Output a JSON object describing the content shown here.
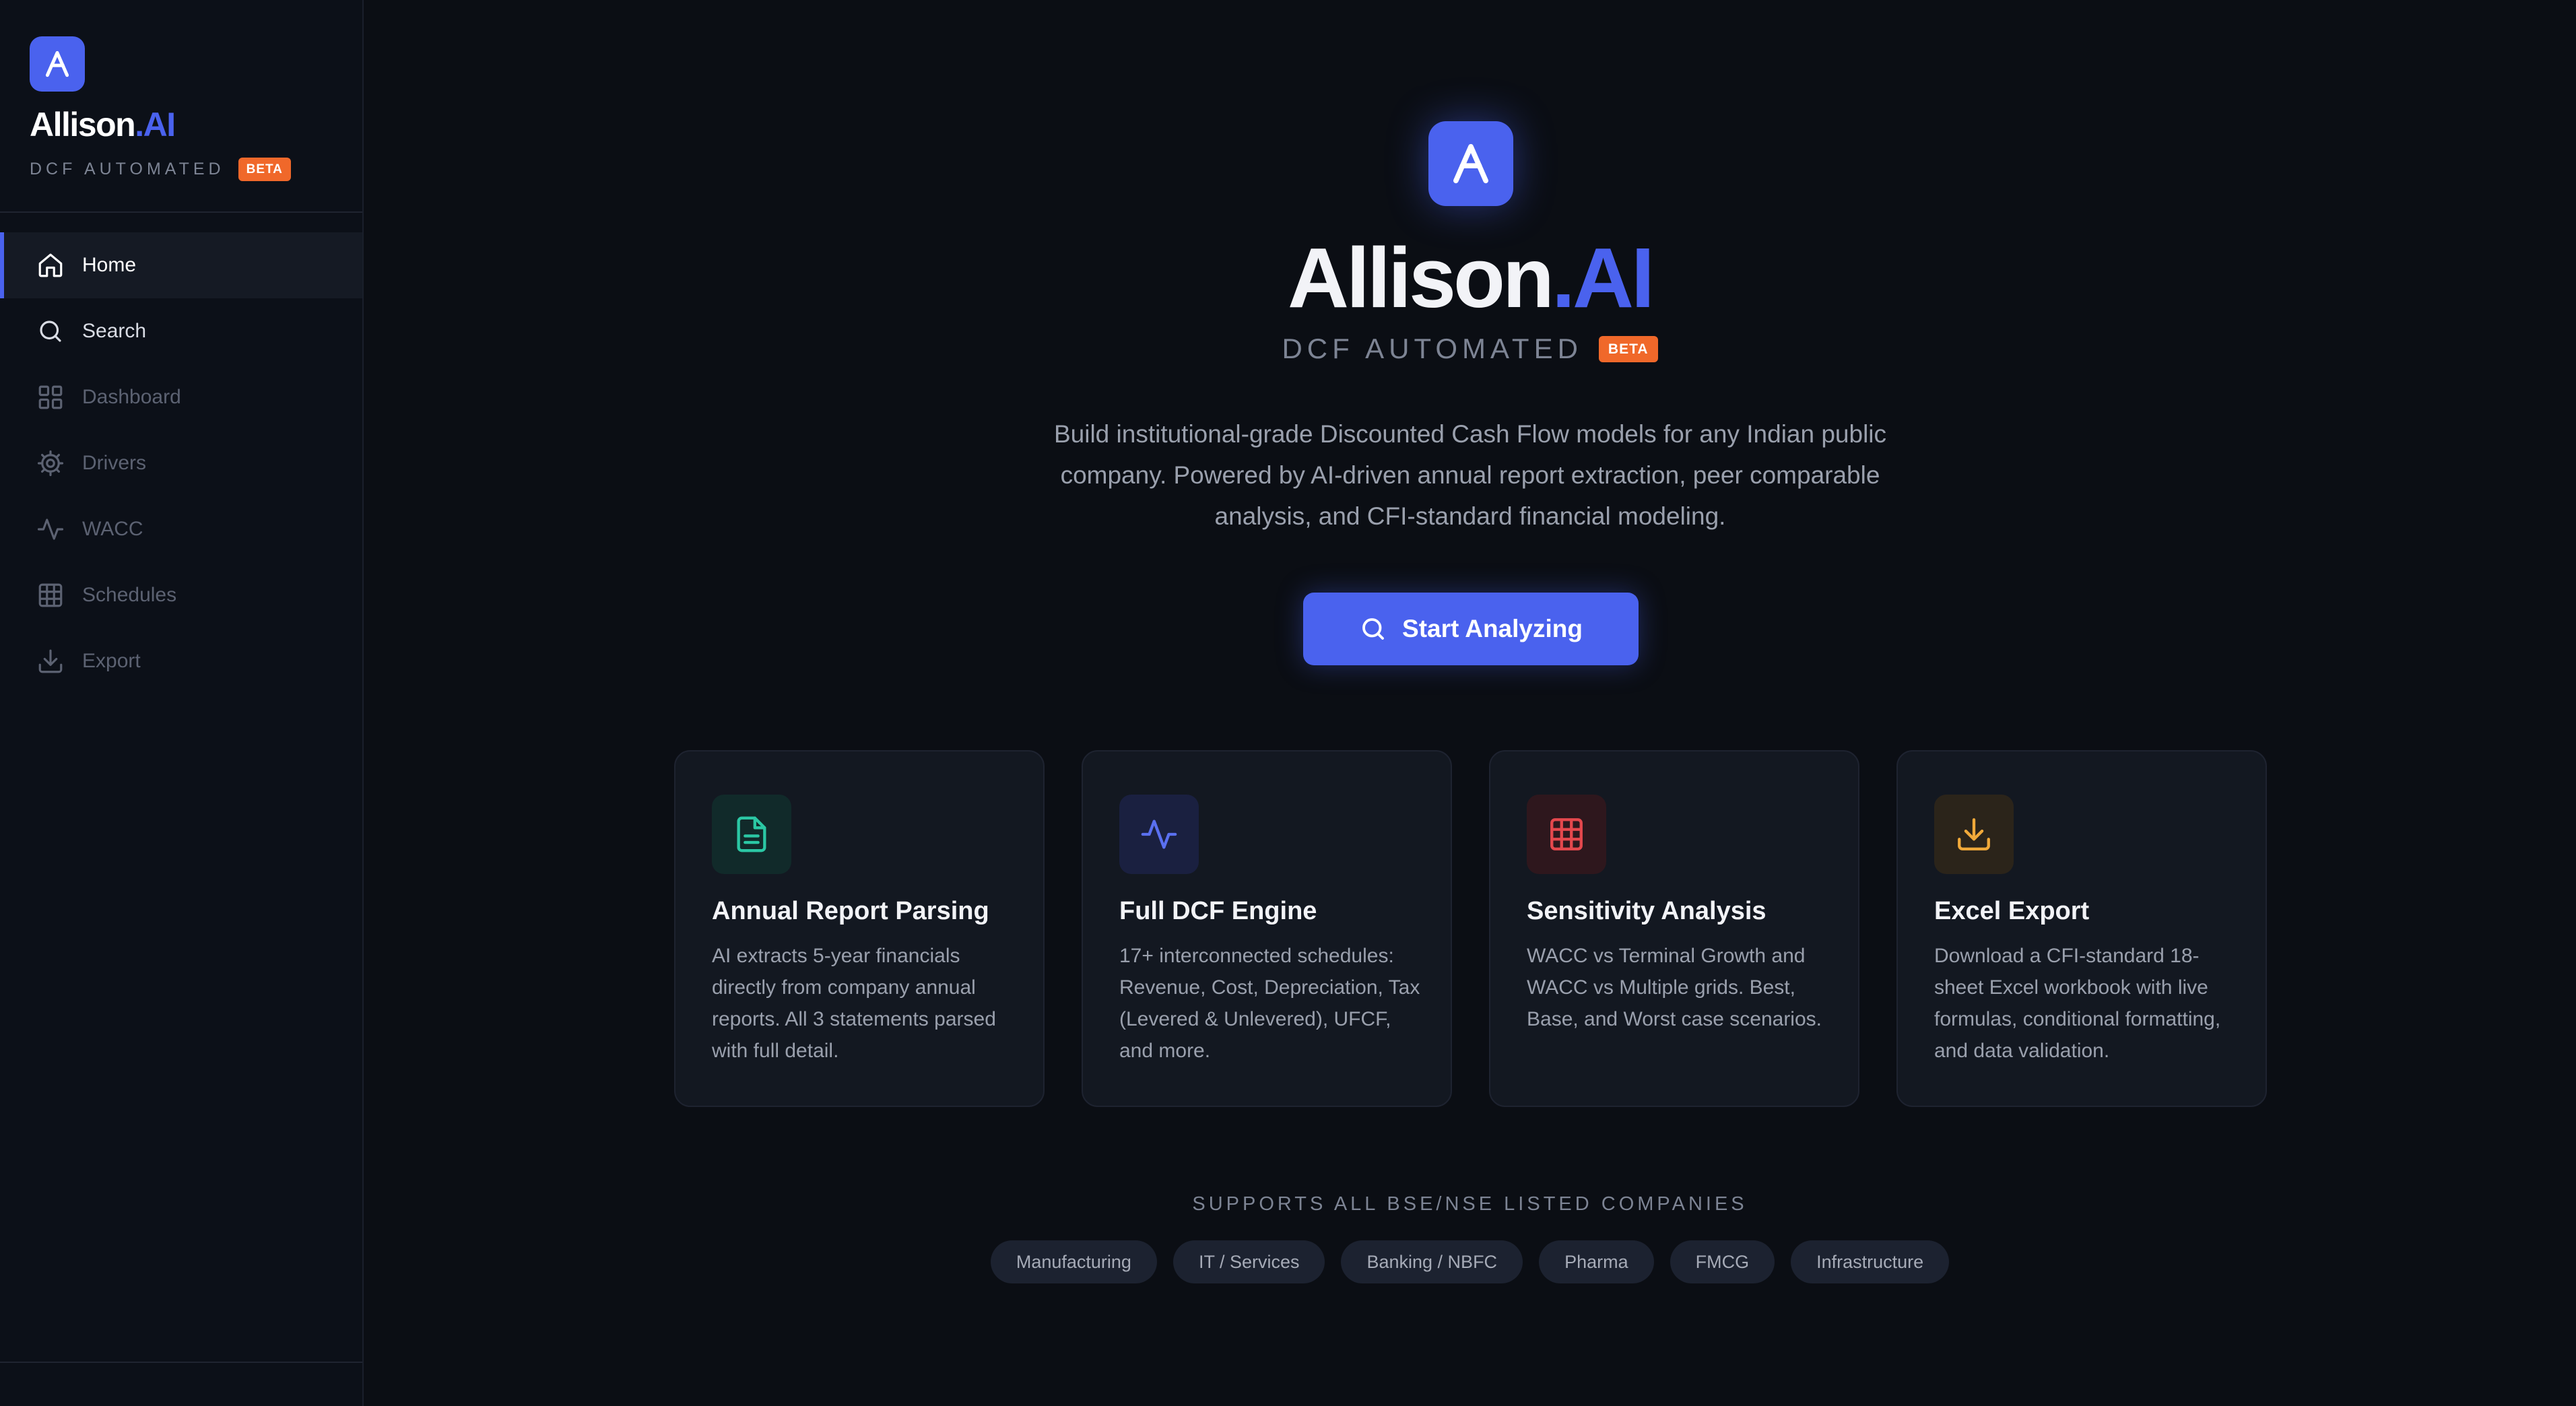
{
  "brand": {
    "name": "Allison",
    "suffix": ".AI",
    "tagline": "DCF AUTOMATED",
    "badge": "BETA",
    "logo_icon": "allison-logo-icon",
    "accent": "#4a62ee",
    "badge_color": "#f0682a"
  },
  "sidebar": {
    "items": [
      {
        "label": "Home",
        "icon": "home-icon",
        "state": "active"
      },
      {
        "label": "Search",
        "icon": "search-icon",
        "state": "enabled"
      },
      {
        "label": "Dashboard",
        "icon": "dashboard-grid-icon",
        "state": "disabled"
      },
      {
        "label": "Drivers",
        "icon": "gear-icon",
        "state": "disabled"
      },
      {
        "label": "WACC",
        "icon": "pulse-icon",
        "state": "disabled"
      },
      {
        "label": "Schedules",
        "icon": "table-grid-icon",
        "state": "disabled"
      },
      {
        "label": "Export",
        "icon": "download-icon",
        "state": "disabled"
      }
    ]
  },
  "hero": {
    "description": "Build institutional-grade Discounted Cash Flow models for any Indian public company. Powered by AI-driven annual report extraction, peer comparable analysis, and CFI-standard financial modeling.",
    "cta_label": "Start Analyzing",
    "cta_icon": "search-icon"
  },
  "features": [
    {
      "title": "Annual Report Parsing",
      "description": "AI extracts 5-year financials directly from company annual reports. All 3 statements parsed with full detail.",
      "icon": "document-icon",
      "color": "#2bc7a4"
    },
    {
      "title": "Full DCF Engine",
      "description": "17+ interconnected schedules: Revenue, Cost, Depreciation, Tax (Levered & Unlevered), UFCF, and more.",
      "icon": "pulse-icon",
      "color": "#5a70f0"
    },
    {
      "title": "Sensitivity Analysis",
      "description": "WACC vs Terminal Growth and WACC vs Multiple grids. Best, Base, and Worst case scenarios.",
      "icon": "table-grid-icon",
      "color": "#e5484d"
    },
    {
      "title": "Excel Export",
      "description": "Download a CFI-standard 18-sheet Excel workbook with live formulas, conditional formatting, and data validation.",
      "icon": "download-icon",
      "color": "#f0a93a"
    }
  ],
  "supports": {
    "heading": "SUPPORTS ALL BSE/NSE LISTED COMPANIES",
    "sectors": [
      "Manufacturing",
      "IT / Services",
      "Banking / NBFC",
      "Pharma",
      "FMCG",
      "Infrastructure"
    ]
  }
}
